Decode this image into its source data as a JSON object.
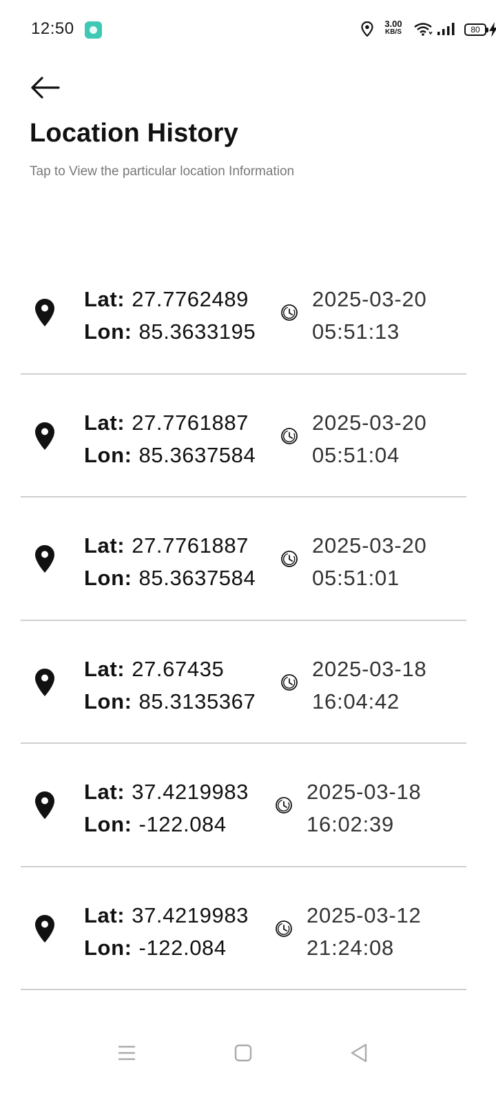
{
  "status_bar": {
    "time": "12:50",
    "net_speed_value": "3.00",
    "net_speed_unit": "KB/S",
    "battery_level": "80",
    "icons": [
      "app-notification-icon",
      "location-icon",
      "wifi-icon",
      "signal-icon",
      "battery-icon",
      "charging-bolt-icon"
    ]
  },
  "header": {
    "back_icon": "arrow-left-icon",
    "title": "Location History",
    "subtitle": "Tap to View the particular location Information"
  },
  "labels": {
    "lat": "Lat:",
    "lon": "Lon:"
  },
  "history": [
    {
      "lat": "27.7762489",
      "lon": "85.3633195",
      "date": "2025-03-20",
      "time": "05:51:13"
    },
    {
      "lat": "27.7761887",
      "lon": "85.3637584",
      "date": "2025-03-20",
      "time": "05:51:04"
    },
    {
      "lat": "27.7761887",
      "lon": "85.3637584",
      "date": "2025-03-20",
      "time": "05:51:01"
    },
    {
      "lat": "27.67435",
      "lon": "85.3135367",
      "date": "2025-03-18",
      "time": "16:04:42"
    },
    {
      "lat": "37.4219983",
      "lon": "-122.084",
      "date": "2025-03-18",
      "time": "16:02:39"
    },
    {
      "lat": "37.4219983",
      "lon": "-122.084",
      "date": "2025-03-12",
      "time": "21:24:08"
    }
  ],
  "nav_bar": {
    "icons": [
      "menu-icon",
      "home-square-icon",
      "back-triangle-icon"
    ]
  },
  "colors": {
    "divider": "#cfcfcf",
    "notification_app": "#3fc8b3",
    "subtitle": "#777777"
  }
}
